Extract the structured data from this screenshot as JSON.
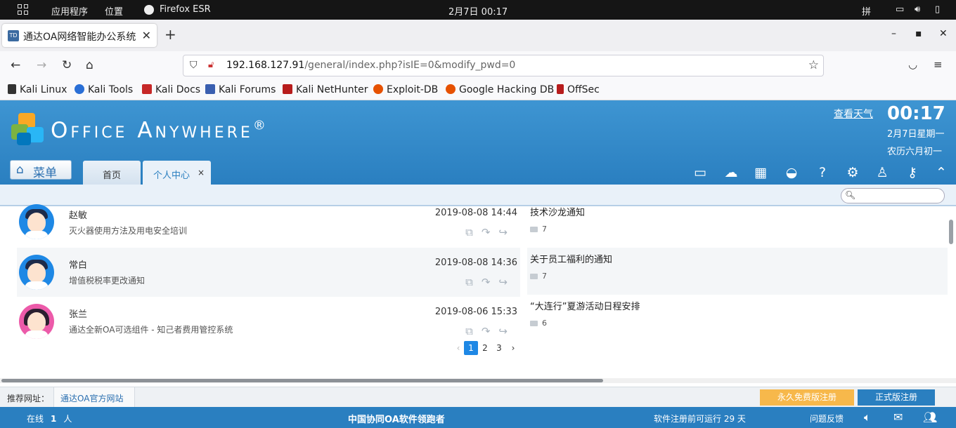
{
  "system_bar": {
    "apps": "应用程序",
    "places": "位置",
    "firefox": "Firefox ESR",
    "datetime": "2月7日  00:17",
    "input_method": "拼"
  },
  "browser": {
    "tab_title": "通达OA网络智能办公系统",
    "tab_favicon": "TD",
    "url_host": "192.168.127.91",
    "url_path": "/general/index.php?isIE=0&modify_pwd=0",
    "bookmarks": [
      "Kali Linux",
      "Kali Tools",
      "Kali Docs",
      "Kali Forums",
      "Kali NetHunter",
      "Exploit-DB",
      "Google Hacking DB",
      "OffSec"
    ]
  },
  "header": {
    "logo_text": "Office Anywhere",
    "logo_mark": "®",
    "weather_link": "查看天气",
    "time": "00:17",
    "date": "2月7日星期一",
    "lunar": "农历六月初一",
    "menu_label": "菜单",
    "tabs": [
      {
        "label": "首页"
      },
      {
        "label": "个人中心",
        "close": "×"
      }
    ]
  },
  "messages": [
    {
      "name": "赵敏",
      "subject": "灭火器使用方法及用电安全培训",
      "datetime": "2019-08-08 14:44"
    },
    {
      "name": "常白",
      "subject": "增值税税率更改通知",
      "datetime": "2019-08-08 14:36"
    },
    {
      "name": "张兰",
      "subject": "通达全新OA可选组件 - 知己者费用管控系统",
      "datetime": "2019-08-06 15:33"
    }
  ],
  "pager": {
    "prev": "‹",
    "pages": [
      "1",
      "2",
      "3"
    ],
    "next": "›",
    "current": "1"
  },
  "notices": [
    {
      "title": "技术沙龙通知",
      "comments": "7"
    },
    {
      "title": "关于员工福利的通知",
      "comments": "7"
    },
    {
      "title": "“大连行”夏游活动日程安排",
      "comments": "6"
    }
  ],
  "recommend": {
    "label": "推荐网址：",
    "link": "通达OA官方网站",
    "free_btn": "永久免费版注册",
    "reg_btn": "正式版注册"
  },
  "status": {
    "online_label": "在线",
    "online_count": "1",
    "online_unit": "人",
    "slogan": "中国协同OA软件领跑者",
    "trial": "软件注册前可运行 29 天",
    "feedback": "问题反馈"
  },
  "colors": {
    "header_blue": "#3e95d2",
    "status_blue": "#2a7fc0",
    "accent_orange": "#f7b84b",
    "pager_blue": "#1e88e5"
  }
}
